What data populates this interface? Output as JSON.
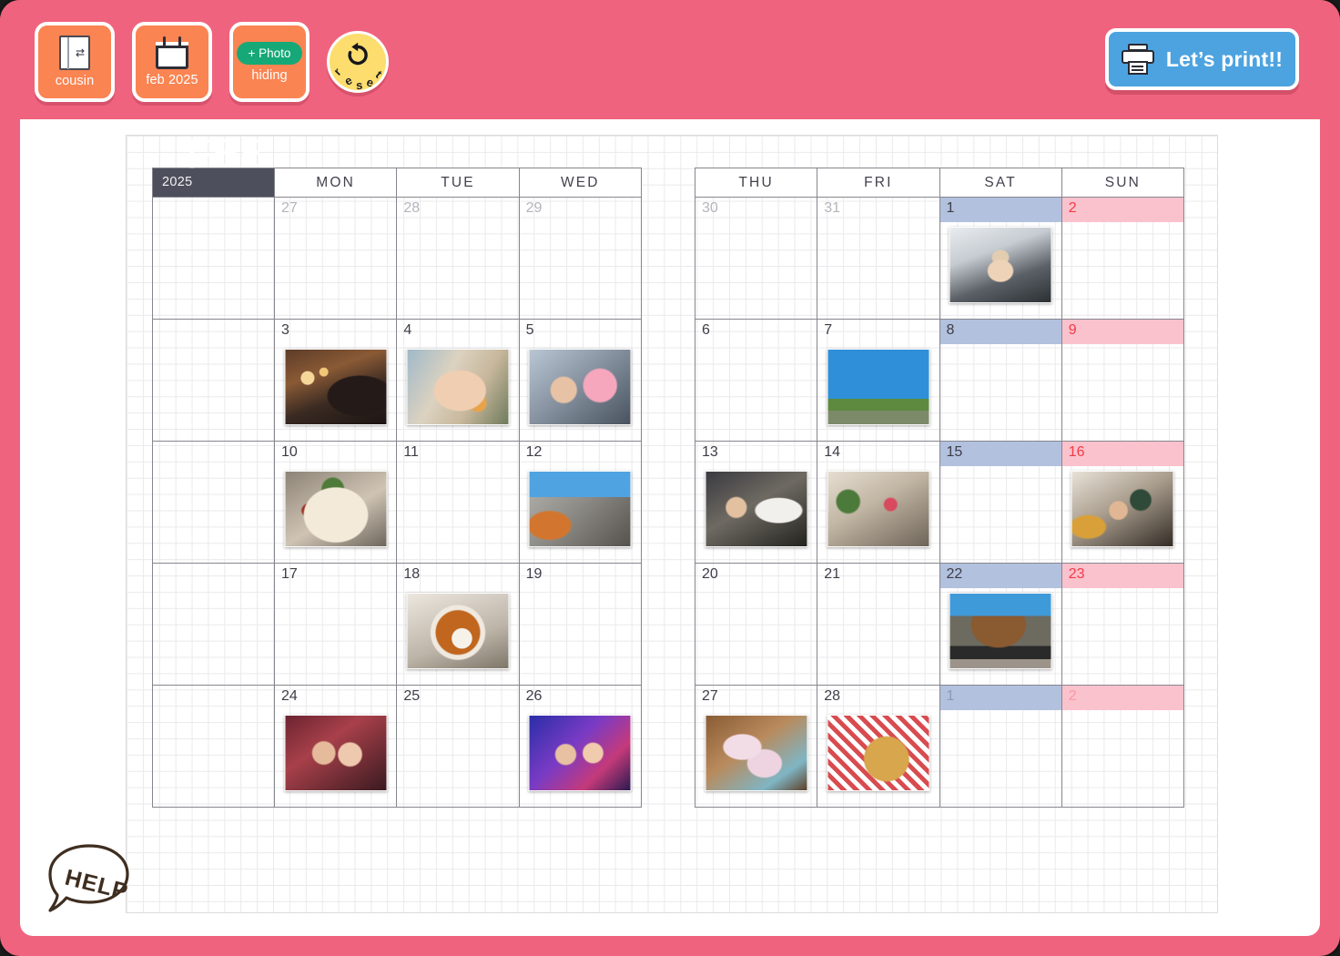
{
  "toolbar": {
    "buttons": [
      {
        "id": "cousin",
        "label": "cousin",
        "icon": "book-icon"
      },
      {
        "id": "feb2025",
        "label": "feb 2025",
        "icon": "calendar-icon"
      },
      {
        "id": "hiding",
        "label": "hiding",
        "icon": "add-photo-icon",
        "pill": "+ Photo"
      }
    ],
    "reset": {
      "label": "reset",
      "letters": [
        "r",
        "e",
        "s",
        "e",
        "t"
      ],
      "icon": "undo-icon"
    },
    "print": {
      "label": "Let’s print!!",
      "icon": "printer-icon"
    }
  },
  "help": {
    "label": "HELP"
  },
  "calendar": {
    "year": "2025",
    "month": "FEB",
    "dow_left": [
      "MON",
      "TUE",
      "WED"
    ],
    "dow_right": [
      "THU",
      "FRI",
      "SAT",
      "SUN"
    ],
    "weeks_left": [
      [
        {
          "num": "27",
          "out": true,
          "photo": null
        },
        {
          "num": "28",
          "out": true,
          "photo": null
        },
        {
          "num": "29",
          "out": true,
          "photo": null
        }
      ],
      [
        {
          "num": "3",
          "out": false,
          "photo": "cafe-portrait"
        },
        {
          "num": "4",
          "out": false,
          "photo": "woman-snack-selfie"
        },
        {
          "num": "5",
          "out": false,
          "photo": "couple-pink-hat"
        }
      ],
      [
        {
          "num": "10",
          "out": false,
          "photo": "steak-plate"
        },
        {
          "num": "11",
          "out": false,
          "photo": null
        },
        {
          "num": "12",
          "out": false,
          "photo": "street-storefront"
        }
      ],
      [
        {
          "num": "17",
          "out": false,
          "photo": null
        },
        {
          "num": "18",
          "out": false,
          "photo": "stew-bowl"
        },
        {
          "num": "19",
          "out": false,
          "photo": null
        }
      ],
      [
        {
          "num": "24",
          "out": false,
          "photo": "couple-party"
        },
        {
          "num": "25",
          "out": false,
          "photo": null
        },
        {
          "num": "26",
          "out": false,
          "photo": "night-club-friends"
        }
      ]
    ],
    "weeks_right": [
      [
        {
          "num": "30",
          "out": true,
          "kind": "thu",
          "photo": null
        },
        {
          "num": "31",
          "out": true,
          "kind": "fri",
          "photo": null
        },
        {
          "num": "1",
          "out": false,
          "kind": "sat",
          "photo": "mirror-selfie-salon"
        },
        {
          "num": "2",
          "out": false,
          "kind": "sun",
          "photo": null
        }
      ],
      [
        {
          "num": "6",
          "out": false,
          "kind": "thu",
          "photo": null
        },
        {
          "num": "7",
          "out": false,
          "kind": "fri",
          "photo": "sculpture-blue-sky"
        },
        {
          "num": "8",
          "out": false,
          "kind": "sat",
          "photo": null
        },
        {
          "num": "9",
          "out": false,
          "kind": "sun",
          "photo": null
        }
      ],
      [
        {
          "num": "13",
          "out": false,
          "kind": "thu",
          "photo": "kitchen-chef"
        },
        {
          "num": "14",
          "out": false,
          "kind": "fri",
          "photo": "shop-interior-flowers"
        },
        {
          "num": "15",
          "out": false,
          "kind": "sat",
          "photo": null
        },
        {
          "num": "16",
          "out": false,
          "kind": "sun",
          "photo": "group-dinner"
        }
      ],
      [
        {
          "num": "20",
          "out": false,
          "kind": "thu",
          "photo": null
        },
        {
          "num": "21",
          "out": false,
          "kind": "fri",
          "photo": null
        },
        {
          "num": "22",
          "out": false,
          "kind": "sat",
          "photo": "autumn-tree-fence"
        },
        {
          "num": "23",
          "out": false,
          "kind": "sun",
          "photo": null
        }
      ],
      [
        {
          "num": "27",
          "out": false,
          "kind": "thu",
          "photo": "pink-cases-table"
        },
        {
          "num": "28",
          "out": false,
          "kind": "fri",
          "photo": "pepperoni-pizza"
        },
        {
          "num": "1",
          "out": true,
          "kind": "sat",
          "photo": null
        },
        {
          "num": "2",
          "out": true,
          "kind": "sun",
          "photo": null
        }
      ]
    ]
  },
  "colors": {
    "header_pink": "#f0637e",
    "tool_orange": "#fa8452",
    "photo_green": "#17a878",
    "reset_yellow": "#fcdd6e",
    "print_blue": "#4da3e0",
    "month_block": "#4d4f5c",
    "saturday_band": "#b2c1de",
    "sunday_band": "#fac2cd",
    "sunday_text": "#f23a46"
  }
}
